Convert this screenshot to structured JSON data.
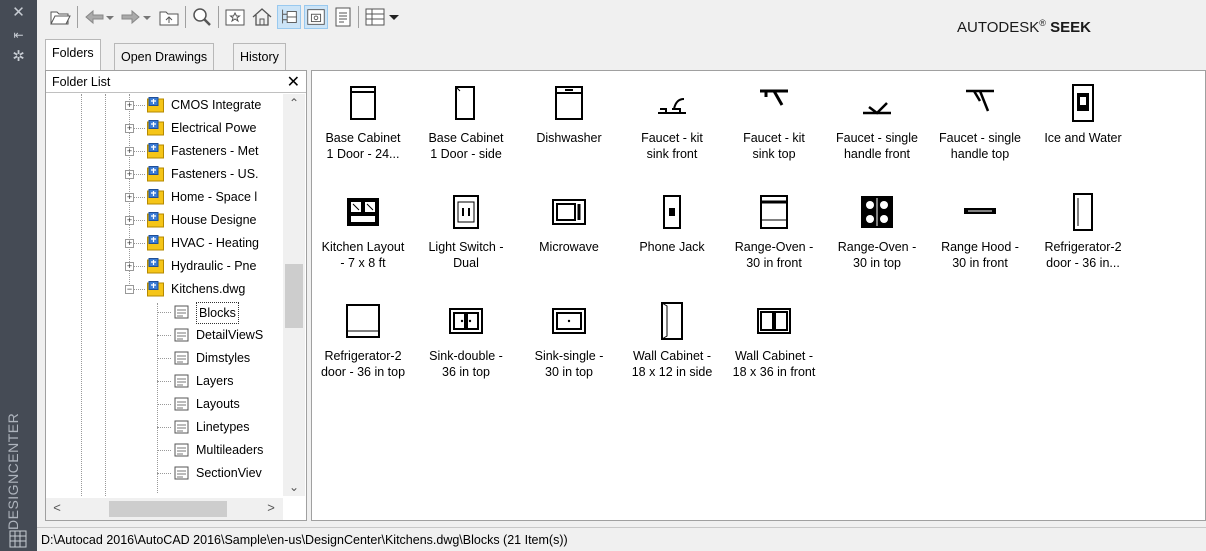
{
  "strip": {
    "close_glyph": "✕",
    "pin_glyph": "⇤",
    "props_glyph": "✲",
    "title": "DESIGNCENTER"
  },
  "toolbar": {
    "icons": [
      "load-icon",
      "back-icon",
      "forward-icon",
      "up-icon",
      "search-icon",
      "favorites-icon",
      "home-icon",
      "tree-view-icon",
      "preview-icon",
      "description-icon",
      "views-icon"
    ],
    "brand_prefix": "AUTODESK",
    "brand_reg": "®",
    "brand_suffix": "SEEK"
  },
  "tabs": [
    "Folders",
    "Open Drawings",
    "History"
  ],
  "folder_list": {
    "title": "Folder List",
    "close_glyph": "✕",
    "folders": [
      "CMOS Integrated",
      "Electrical Power",
      "Fasteners - Metric",
      "Fasteners - US",
      "Home - Space Planner",
      "House Designer",
      "HVAC - Heating",
      "Hydraulic - Pneumatic",
      "Kitchens.dwg"
    ],
    "folder_display": [
      "CMOS Integrate",
      "Electrical Powe",
      "Fasteners - Met",
      "Fasteners - US.",
      "Home - Space l",
      "House Designe",
      "HVAC - Heating",
      "Hydraulic - Pne",
      "Kitchens.dwg"
    ],
    "children": [
      "Blocks",
      "DetailViewS",
      "Dimstyles",
      "Layers",
      "Layouts",
      "Linetypes",
      "Multileaders",
      "SectionViev"
    ],
    "selected": "Blocks"
  },
  "items": [
    {
      "line1": "Base Cabinet",
      "line2": "1 Door - 24..."
    },
    {
      "line1": "Base Cabinet",
      "line2": "1 Door - side"
    },
    {
      "line1": "Dishwasher",
      "line2": ""
    },
    {
      "line1": "Faucet - kit",
      "line2": "sink front"
    },
    {
      "line1": "Faucet - kit",
      "line2": "sink top"
    },
    {
      "line1": "Faucet - single",
      "line2": "handle front"
    },
    {
      "line1": "Faucet - single",
      "line2": "handle top"
    },
    {
      "line1": "Ice and Water",
      "line2": ""
    },
    {
      "line1": "Kitchen Layout",
      "line2": "- 7 x 8 ft"
    },
    {
      "line1": "Light Switch -",
      "line2": "Dual"
    },
    {
      "line1": "Microwave",
      "line2": ""
    },
    {
      "line1": "Phone Jack",
      "line2": ""
    },
    {
      "line1": "Range-Oven -",
      "line2": "30 in front"
    },
    {
      "line1": "Range-Oven -",
      "line2": "30 in top"
    },
    {
      "line1": "Range Hood -",
      "line2": "30 in front"
    },
    {
      "line1": "Refrigerator-2",
      "line2": "door - 36 in..."
    },
    {
      "line1": "Refrigerator-2",
      "line2": "door - 36 in top"
    },
    {
      "line1": "Sink-double -",
      "line2": "36 in top"
    },
    {
      "line1": "Sink-single -",
      "line2": "30 in top"
    },
    {
      "line1": "Wall Cabinet -",
      "line2": "18 x 12 in side"
    },
    {
      "line1": "Wall Cabinet -",
      "line2": "18 x 36 in front"
    }
  ],
  "status": {
    "path": "D:\\Autocad 2016\\AutoCAD 2016\\Sample\\en-us\\DesignCenter\\Kitchens.dwg\\Blocks (21 Item(s))"
  }
}
